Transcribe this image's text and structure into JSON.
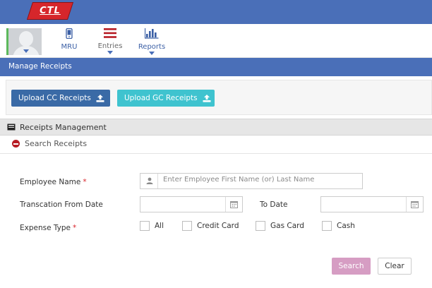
{
  "brand": {
    "logo_text": "CTL",
    "colors": {
      "topbar": "#4a6fb8",
      "logo": "#d6262b"
    }
  },
  "nav": {
    "items": [
      {
        "label": "MRU",
        "icon": "mobile-icon"
      },
      {
        "label": "Entries",
        "icon": "menu-bars-icon"
      },
      {
        "label": "Reports",
        "icon": "bar-chart-icon"
      }
    ]
  },
  "breadcrumb": {
    "title": "Manage Receipts"
  },
  "upload": {
    "cc_label": "Upload CC Receipts",
    "gc_label": "Upload GC Receipts",
    "colors": {
      "cc": "#3a6aa6",
      "gc": "#3fc3cf"
    }
  },
  "section": {
    "title": "Receipts Management"
  },
  "panel": {
    "title": "Search Receipts"
  },
  "form": {
    "employee_label": "Employee Name",
    "required_mark": "*",
    "employee_placeholder": "Enter Employee First Name (or) Last Name",
    "from_date_label": "Transcation From Date",
    "to_date_label": "To Date",
    "expense_label": "Expense Type",
    "expense_options": [
      "All",
      "Credit Card",
      "Gas Card",
      "Cash"
    ]
  },
  "actions": {
    "search_label": "Search",
    "clear_label": "Clear",
    "colors": {
      "search": "#d69dc3"
    }
  }
}
